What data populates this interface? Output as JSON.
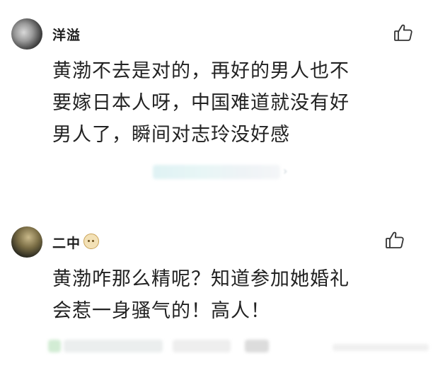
{
  "comments": [
    {
      "username": "洋溢",
      "text": "黄渤不去是对的，再好的男人也不\n要嫁日本人呀，中国难道就没有好\n男人了，瞬间对志玲没好感",
      "like_icon": "thumbs-up-outline-icon",
      "reply_chevron": "›"
    },
    {
      "username": "二中",
      "badge_icon": "monkey-face-badge-icon",
      "text": "黄渤咋那么精呢？知道参加她婚礼\n会惹一身骚气的！高人！",
      "like_icon": "thumbs-up-outline-icon"
    }
  ]
}
